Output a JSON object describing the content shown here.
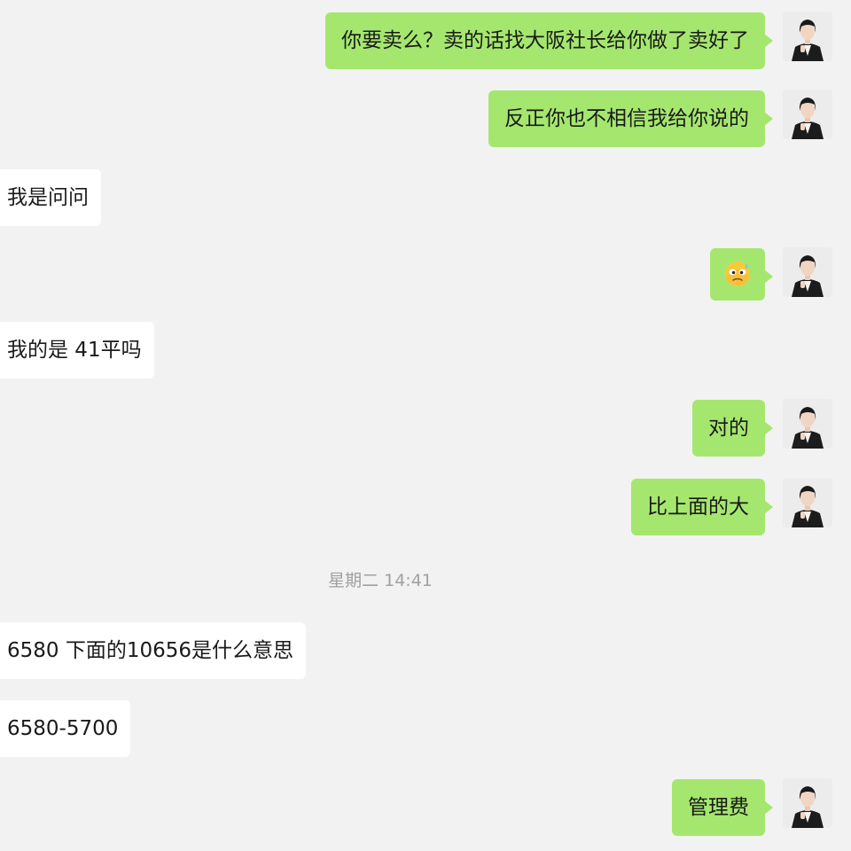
{
  "colors": {
    "background": "#f2f2f2",
    "sent_bubble": "#a5e76e",
    "received_bubble": "#ffffff",
    "timestamp_text": "#a0a0a0"
  },
  "messages": [
    {
      "side": "right",
      "type": "text",
      "text": "你要卖么？卖的话找大阪社长给你做了卖好了"
    },
    {
      "side": "right",
      "type": "text",
      "text": "反正你也不相信我给你说的"
    },
    {
      "side": "left",
      "type": "text",
      "text": "我是问问"
    },
    {
      "side": "right",
      "type": "emoji",
      "icon": "sweat-smile-emoji-icon"
    },
    {
      "side": "left",
      "type": "text",
      "text": "我的是 41平吗"
    },
    {
      "side": "right",
      "type": "text",
      "text": "对的"
    },
    {
      "side": "right",
      "type": "text",
      "text": "比上面的大"
    },
    {
      "side": "left",
      "type": "text",
      "text": "6580 下面的10656是什么意思"
    },
    {
      "side": "left",
      "type": "text",
      "text": "6580-5700"
    },
    {
      "side": "right",
      "type": "text",
      "text": "管理费"
    }
  ],
  "timestamp": "星期二 14:41"
}
